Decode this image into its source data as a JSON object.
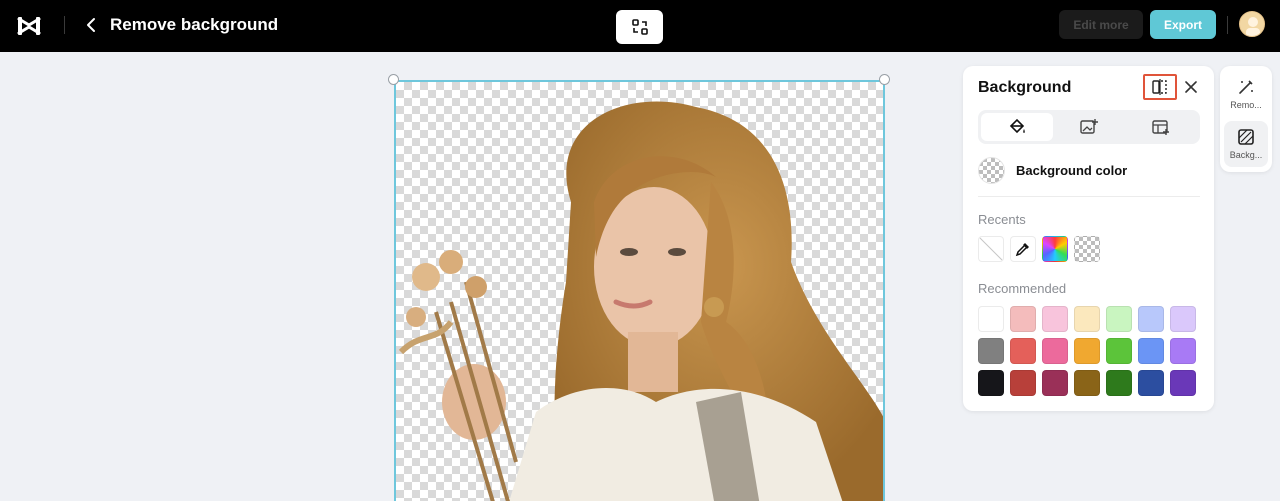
{
  "header": {
    "title": "Remove background",
    "edit_more_label": "Edit more",
    "export_label": "Export"
  },
  "panel": {
    "title": "Background",
    "background_color_label": "Background color",
    "recents_label": "Recents",
    "recommended_label": "Recommended",
    "recents": [
      "none-icon",
      "eyedropper-icon",
      "gradient-swatch",
      "transparent-swatch"
    ],
    "recommended": [
      [
        "#ffffff",
        "#f4bcbc",
        "#f8c4dc",
        "#fbe8bd",
        "#c9f5c0",
        "#b8c8fb",
        "#dac8fb"
      ],
      [
        "#808080",
        "#e4605a",
        "#ec6a9c",
        "#f0a830",
        "#5cc43a",
        "#6b95f5",
        "#a87af5"
      ],
      [
        "#16161a",
        "#b8403a",
        "#9a3058",
        "#8a6418",
        "#2e7a1c",
        "#2c4ea0",
        "#6a38b8"
      ]
    ]
  },
  "rail": {
    "items": [
      {
        "label": "Remo...",
        "icon": "magic-eraser-icon"
      },
      {
        "label": "Backg...",
        "icon": "background-icon"
      }
    ]
  },
  "colors": {
    "accent": "#5fc8d6",
    "canvas_border": "#6ec7dc",
    "highlight": "#e0543a"
  }
}
